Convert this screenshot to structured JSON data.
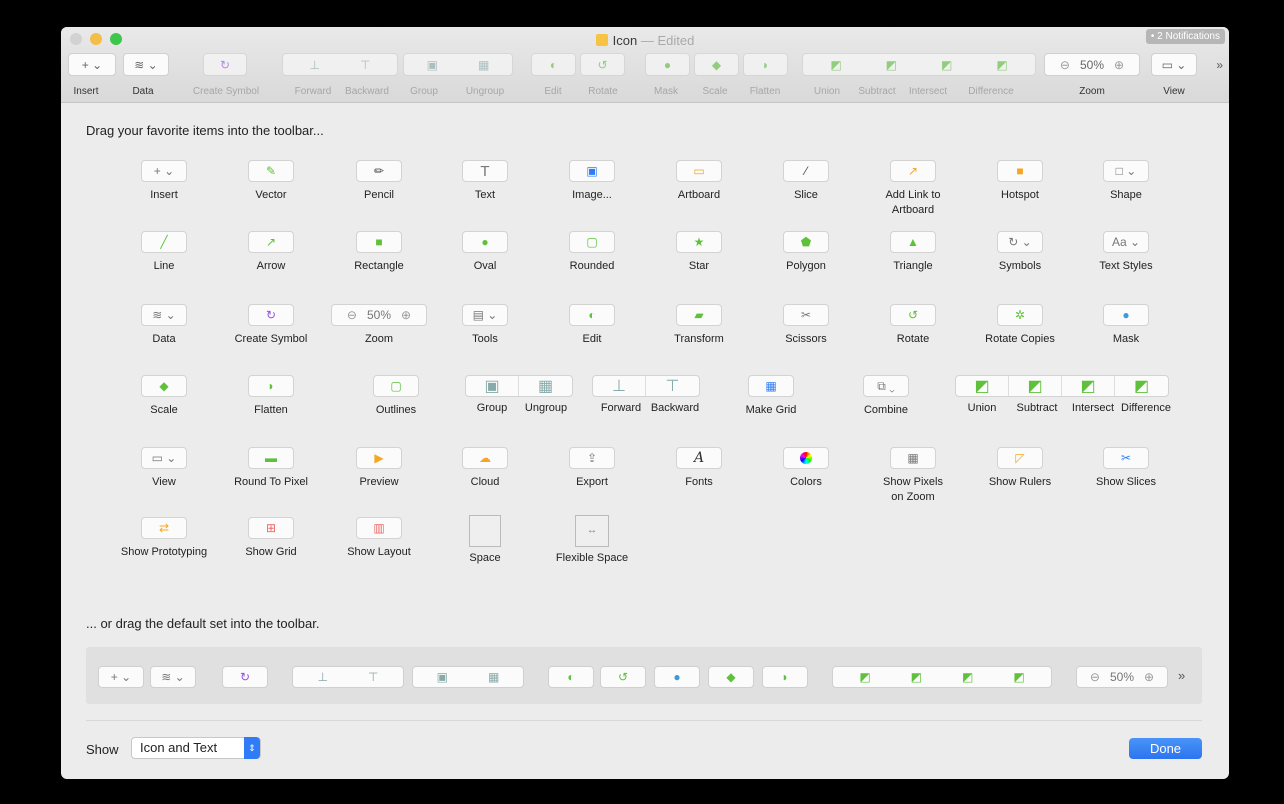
{
  "window": {
    "title": "Icon",
    "title_suffix": "— Edited",
    "notifications": "• 2 Notifications"
  },
  "toolbar": {
    "labels": [
      "Insert",
      "Data",
      "Create Symbol",
      "Forward",
      "Backward",
      "Group",
      "Ungroup",
      "Edit",
      "Rotate",
      "Mask",
      "Scale",
      "Flatten",
      "Union",
      "Subtract",
      "Intersect",
      "Difference",
      "Zoom",
      "View"
    ],
    "zoom_value": "50%",
    "overflow": "»"
  },
  "palette": {
    "heading": "Drag your favorite items into the toolbar...",
    "items": [
      "Insert",
      "Vector",
      "Pencil",
      "Text",
      "Image...",
      "Artboard",
      "Slice",
      "Add Link to Artboard",
      "Hotspot",
      "Shape",
      "Line",
      "Arrow",
      "Rectangle",
      "Oval",
      "Rounded",
      "Star",
      "Polygon",
      "Triangle",
      "Symbols",
      "Text Styles",
      "Data",
      "Create Symbol",
      "Zoom",
      "Tools",
      "Edit",
      "Transform",
      "Scissors",
      "Rotate",
      "Rotate Copies",
      "Mask",
      "Scale",
      "Flatten",
      "Outlines",
      "Group",
      "Ungroup",
      "Forward",
      "Backward",
      "Make Grid",
      "Combine",
      "Union",
      "Subtract",
      "Intersect",
      "Difference",
      "View",
      "Round To Pixel",
      "Preview",
      "Cloud",
      "Export",
      "Fonts",
      "Colors",
      "Show Pixels on Zoom",
      "Show Rulers",
      "Show Slices",
      "Show Prototyping",
      "Show Grid",
      "Show Layout",
      "Space",
      "Flexible Space"
    ],
    "zoom_value": "50%",
    "text_styles_glyph": "Aa",
    "text_glyph": "T",
    "fonts_glyph": "A"
  },
  "default_set": {
    "heading": "... or drag the default set into the toolbar.",
    "zoom_value": "50%",
    "overflow": "»"
  },
  "footer": {
    "show_label": "Show",
    "show_value": "Icon and Text",
    "done_label": "Done"
  },
  "colors": {
    "accent": "#2f7cf6",
    "green": "#5fc13b",
    "purple": "#9b4ee0",
    "orange": "#f5a623"
  }
}
